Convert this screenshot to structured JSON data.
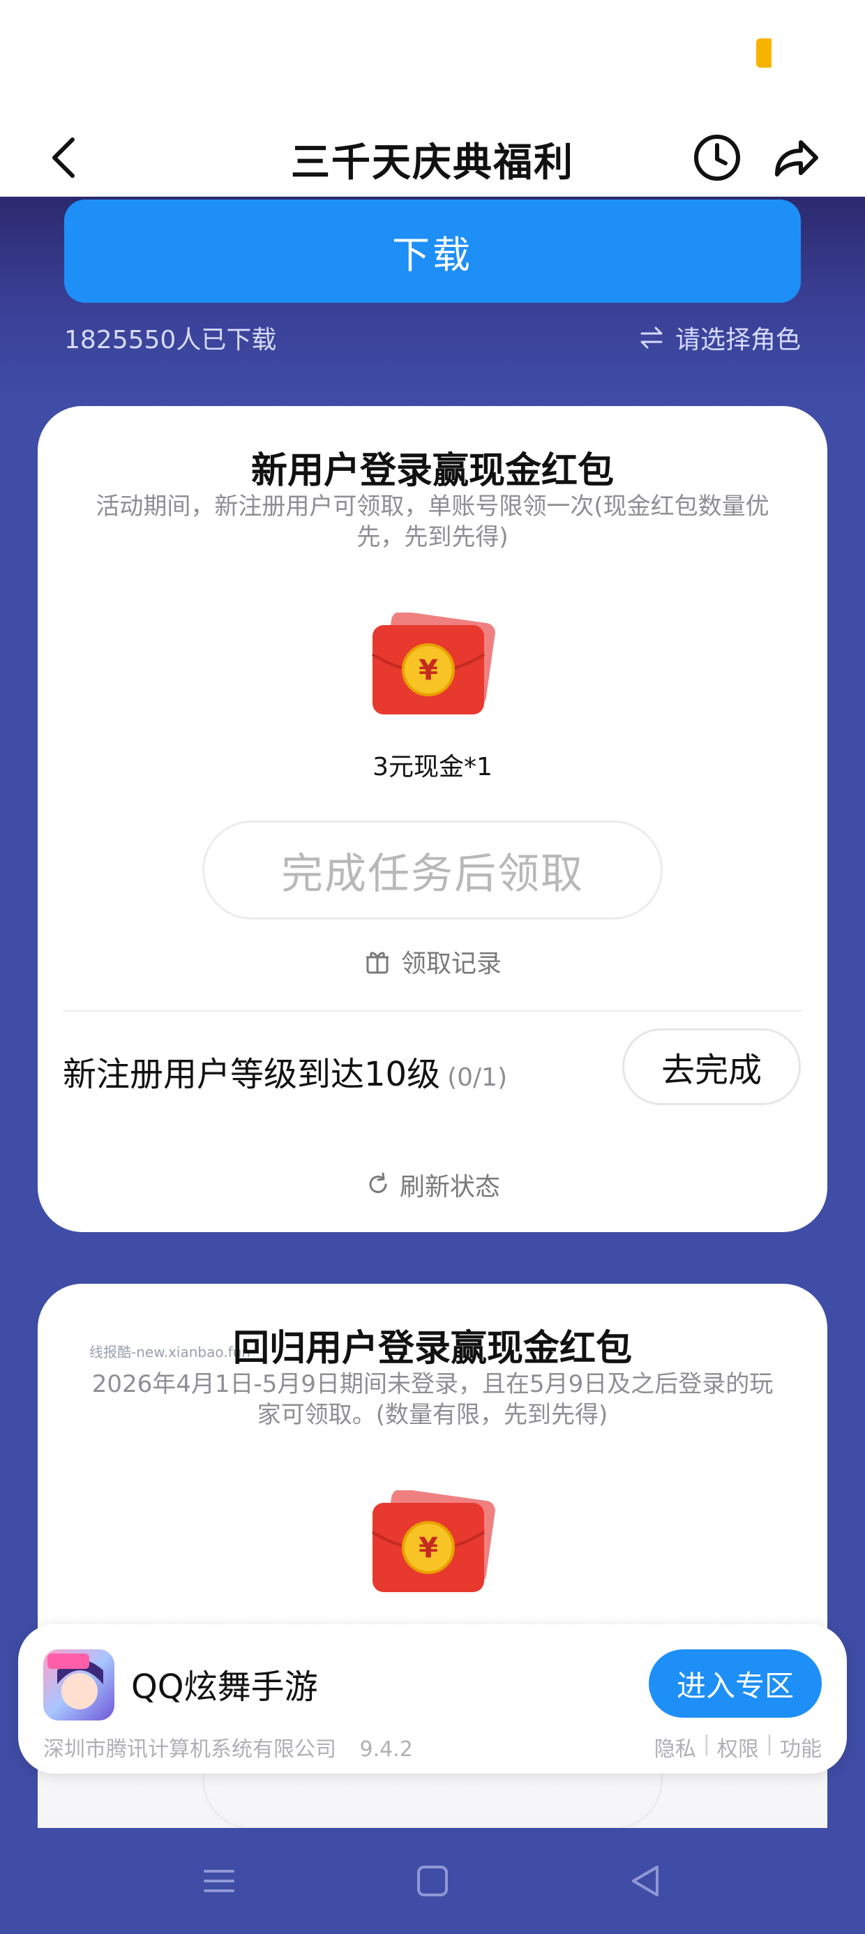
{
  "nav": {
    "title": "三千天庆典福利"
  },
  "hero": {
    "download_label": "下载",
    "download_count": "1825550人已下载",
    "select_role_label": "请选择角色"
  },
  "card1": {
    "title": "新用户登录赢现金红包",
    "description": "活动期间，新注册用户可领取，单账号限领一次(现金红包数量优先，先到先得)",
    "reward_label": "3元现金*1",
    "claim_button": "完成任务后领取",
    "claim_record": "领取记录",
    "task_text": "新注册用户等级到达10级",
    "task_progress": "(0/1)",
    "task_button": "去完成",
    "refresh_label": "刷新状态"
  },
  "card2": {
    "watermark": "线报酷-new.xianbao.fun",
    "title": "回归用户登录赢现金红包",
    "description": "2026年4月1日-5月9日期间未登录，且在5月9日及之后登录的玩家可领取。(数量有限，先到先得)"
  },
  "appbar": {
    "app_name": "QQ炫舞手游",
    "enter_button": "进入专区",
    "company": "深圳市腾讯计算机系统有限公司",
    "version": "9.4.2",
    "links": [
      "隐私",
      "权限",
      "功能"
    ]
  },
  "colors": {
    "accent": "#1e8ff7",
    "background": "#3f4da6",
    "redpacket": "#e8392e",
    "coin": "#f7c325"
  },
  "icons": [
    "back-icon",
    "clock-icon",
    "share-icon",
    "swap-icon",
    "gift-icon",
    "refresh-icon",
    "red-packet-icon",
    "menu-icon",
    "home-icon",
    "back-triangle-icon"
  ]
}
